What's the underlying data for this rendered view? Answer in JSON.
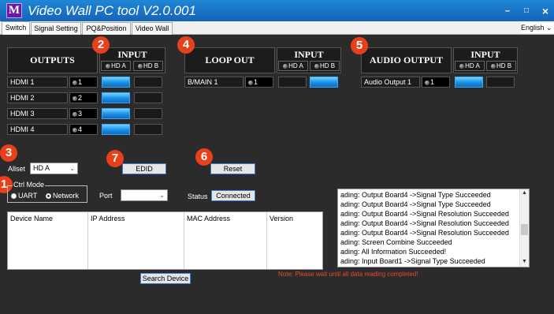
{
  "window": {
    "title": "Video Wall PC tool V2.0.001",
    "logo": "M",
    "min": "–",
    "max": "□",
    "close": "×",
    "corner_text": "I"
  },
  "tabs": [
    {
      "label": "Switch"
    },
    {
      "label": "Signal Setting"
    },
    {
      "label": "PQ&Position"
    },
    {
      "label": "Video Wall"
    }
  ],
  "language": "English",
  "input_header": "INPUT",
  "input_buttons": [
    "HD A",
    "HD B"
  ],
  "outputs": {
    "title": "OUTPUTS",
    "rows": [
      {
        "label": "HDMI 1",
        "value": "1",
        "route": [
          true,
          false
        ]
      },
      {
        "label": "HDMI 2",
        "value": "2",
        "route": [
          true,
          false
        ]
      },
      {
        "label": "HDMI 3",
        "value": "3",
        "route": [
          true,
          false
        ]
      },
      {
        "label": "HDMI 4",
        "value": "4",
        "route": [
          true,
          false
        ]
      }
    ]
  },
  "loop_out": {
    "title": "LOOP OUT",
    "row": {
      "label": "B/MAIN 1",
      "value": "1",
      "route": [
        false,
        true
      ]
    }
  },
  "audio_output": {
    "title": "AUDIO OUTPUT",
    "row": {
      "label": "Audio Output 1",
      "value": "1",
      "route": [
        true,
        false
      ]
    }
  },
  "badges": [
    "1",
    "2",
    "3",
    "4",
    "5",
    "6",
    "7"
  ],
  "allset": {
    "label": "Allset",
    "value": "HD A"
  },
  "edid_button": "EDID",
  "reset_button": "Reset",
  "ctrl_mode": {
    "label": "Ctrl Mode",
    "options": [
      "UART",
      "Network"
    ],
    "selected": "Network"
  },
  "port": {
    "label": "Port",
    "value": ""
  },
  "status": {
    "label": "Status",
    "value": "Connected"
  },
  "device_table": {
    "headers": [
      "Device Name",
      "IP Address",
      "MAC Address",
      "Version"
    ]
  },
  "search_button": "Search Device",
  "log_lines": [
    "ading: Output Board4 ->Signal Type Succeeded",
    "ading: Output Board4 ->Signal Type Succeeded",
    "ading: Output Board4 ->Signal Resolution Succeeded",
    "ading: Output Board4 ->Signal Resolution Succeeded",
    "ading: Output Board4 ->Signal Resolution Succeeded",
    "ading: Screen Combine Succeeded",
    "ading: All Information Succeeded!",
    "ading: Input Board1 ->Signal Type Succeeded"
  ],
  "note": "Note: Please wait until all data reading completed!",
  "colors": {
    "accent": "#1a8fe6",
    "badge": "#e8401a",
    "note": "#e84a2a",
    "titlebar": "#1563b8"
  }
}
